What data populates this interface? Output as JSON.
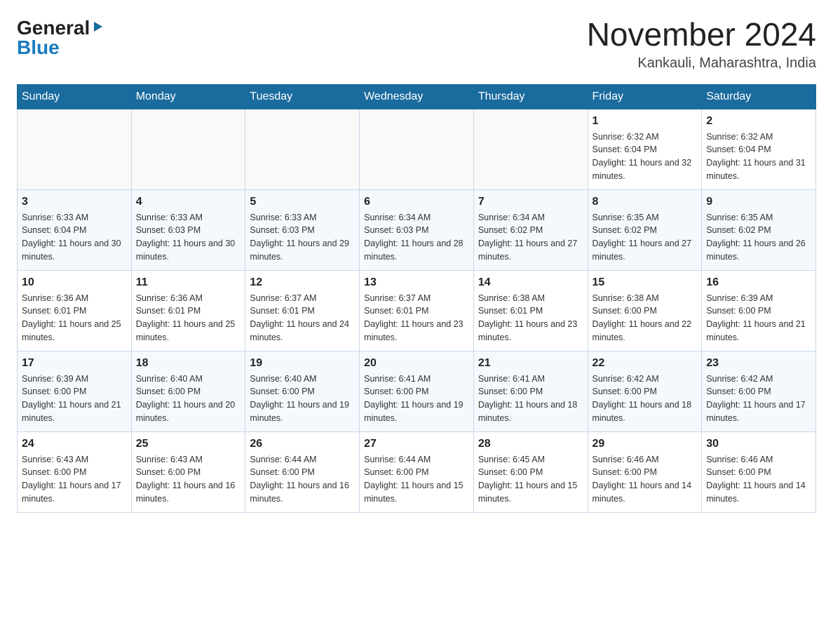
{
  "logo": {
    "general": "General",
    "blue": "Blue"
  },
  "title": {
    "month_year": "November 2024",
    "location": "Kankauli, Maharashtra, India"
  },
  "weekdays": [
    "Sunday",
    "Monday",
    "Tuesday",
    "Wednesday",
    "Thursday",
    "Friday",
    "Saturday"
  ],
  "weeks": [
    [
      {
        "day": "",
        "info": ""
      },
      {
        "day": "",
        "info": ""
      },
      {
        "day": "",
        "info": ""
      },
      {
        "day": "",
        "info": ""
      },
      {
        "day": "",
        "info": ""
      },
      {
        "day": "1",
        "info": "Sunrise: 6:32 AM\nSunset: 6:04 PM\nDaylight: 11 hours and 32 minutes."
      },
      {
        "day": "2",
        "info": "Sunrise: 6:32 AM\nSunset: 6:04 PM\nDaylight: 11 hours and 31 minutes."
      }
    ],
    [
      {
        "day": "3",
        "info": "Sunrise: 6:33 AM\nSunset: 6:04 PM\nDaylight: 11 hours and 30 minutes."
      },
      {
        "day": "4",
        "info": "Sunrise: 6:33 AM\nSunset: 6:03 PM\nDaylight: 11 hours and 30 minutes."
      },
      {
        "day": "5",
        "info": "Sunrise: 6:33 AM\nSunset: 6:03 PM\nDaylight: 11 hours and 29 minutes."
      },
      {
        "day": "6",
        "info": "Sunrise: 6:34 AM\nSunset: 6:03 PM\nDaylight: 11 hours and 28 minutes."
      },
      {
        "day": "7",
        "info": "Sunrise: 6:34 AM\nSunset: 6:02 PM\nDaylight: 11 hours and 27 minutes."
      },
      {
        "day": "8",
        "info": "Sunrise: 6:35 AM\nSunset: 6:02 PM\nDaylight: 11 hours and 27 minutes."
      },
      {
        "day": "9",
        "info": "Sunrise: 6:35 AM\nSunset: 6:02 PM\nDaylight: 11 hours and 26 minutes."
      }
    ],
    [
      {
        "day": "10",
        "info": "Sunrise: 6:36 AM\nSunset: 6:01 PM\nDaylight: 11 hours and 25 minutes."
      },
      {
        "day": "11",
        "info": "Sunrise: 6:36 AM\nSunset: 6:01 PM\nDaylight: 11 hours and 25 minutes."
      },
      {
        "day": "12",
        "info": "Sunrise: 6:37 AM\nSunset: 6:01 PM\nDaylight: 11 hours and 24 minutes."
      },
      {
        "day": "13",
        "info": "Sunrise: 6:37 AM\nSunset: 6:01 PM\nDaylight: 11 hours and 23 minutes."
      },
      {
        "day": "14",
        "info": "Sunrise: 6:38 AM\nSunset: 6:01 PM\nDaylight: 11 hours and 23 minutes."
      },
      {
        "day": "15",
        "info": "Sunrise: 6:38 AM\nSunset: 6:00 PM\nDaylight: 11 hours and 22 minutes."
      },
      {
        "day": "16",
        "info": "Sunrise: 6:39 AM\nSunset: 6:00 PM\nDaylight: 11 hours and 21 minutes."
      }
    ],
    [
      {
        "day": "17",
        "info": "Sunrise: 6:39 AM\nSunset: 6:00 PM\nDaylight: 11 hours and 21 minutes."
      },
      {
        "day": "18",
        "info": "Sunrise: 6:40 AM\nSunset: 6:00 PM\nDaylight: 11 hours and 20 minutes."
      },
      {
        "day": "19",
        "info": "Sunrise: 6:40 AM\nSunset: 6:00 PM\nDaylight: 11 hours and 19 minutes."
      },
      {
        "day": "20",
        "info": "Sunrise: 6:41 AM\nSunset: 6:00 PM\nDaylight: 11 hours and 19 minutes."
      },
      {
        "day": "21",
        "info": "Sunrise: 6:41 AM\nSunset: 6:00 PM\nDaylight: 11 hours and 18 minutes."
      },
      {
        "day": "22",
        "info": "Sunrise: 6:42 AM\nSunset: 6:00 PM\nDaylight: 11 hours and 18 minutes."
      },
      {
        "day": "23",
        "info": "Sunrise: 6:42 AM\nSunset: 6:00 PM\nDaylight: 11 hours and 17 minutes."
      }
    ],
    [
      {
        "day": "24",
        "info": "Sunrise: 6:43 AM\nSunset: 6:00 PM\nDaylight: 11 hours and 17 minutes."
      },
      {
        "day": "25",
        "info": "Sunrise: 6:43 AM\nSunset: 6:00 PM\nDaylight: 11 hours and 16 minutes."
      },
      {
        "day": "26",
        "info": "Sunrise: 6:44 AM\nSunset: 6:00 PM\nDaylight: 11 hours and 16 minutes."
      },
      {
        "day": "27",
        "info": "Sunrise: 6:44 AM\nSunset: 6:00 PM\nDaylight: 11 hours and 15 minutes."
      },
      {
        "day": "28",
        "info": "Sunrise: 6:45 AM\nSunset: 6:00 PM\nDaylight: 11 hours and 15 minutes."
      },
      {
        "day": "29",
        "info": "Sunrise: 6:46 AM\nSunset: 6:00 PM\nDaylight: 11 hours and 14 minutes."
      },
      {
        "day": "30",
        "info": "Sunrise: 6:46 AM\nSunset: 6:00 PM\nDaylight: 11 hours and 14 minutes."
      }
    ]
  ]
}
